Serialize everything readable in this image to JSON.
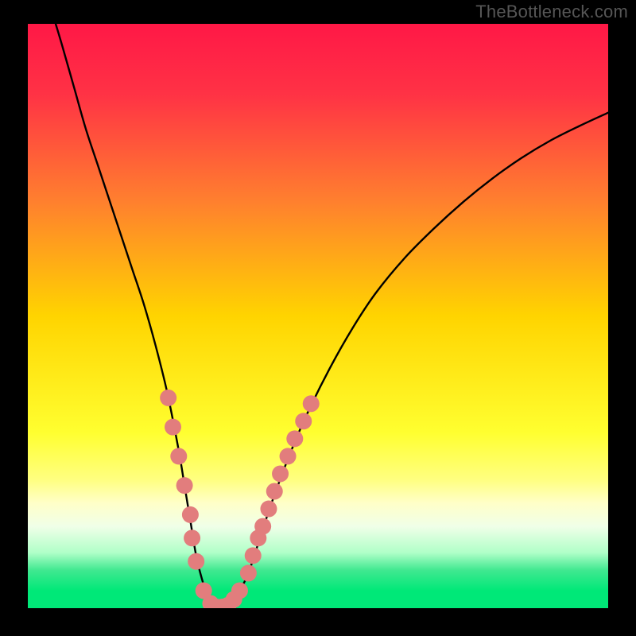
{
  "watermark": "TheBottleneck.com",
  "chart_data": {
    "type": "line",
    "title": "",
    "xlabel": "",
    "ylabel": "",
    "xlim": [
      0,
      100
    ],
    "ylim": [
      0,
      100
    ],
    "gradient_stops": [
      {
        "pos": 0.0,
        "color": "#ff1846"
      },
      {
        "pos": 0.12,
        "color": "#ff3245"
      },
      {
        "pos": 0.3,
        "color": "#ff7e2f"
      },
      {
        "pos": 0.5,
        "color": "#ffd400"
      },
      {
        "pos": 0.7,
        "color": "#ffff30"
      },
      {
        "pos": 0.78,
        "color": "#ffff80"
      },
      {
        "pos": 0.82,
        "color": "#ffffc8"
      },
      {
        "pos": 0.86,
        "color": "#f0ffe8"
      },
      {
        "pos": 0.905,
        "color": "#b0ffc8"
      },
      {
        "pos": 0.935,
        "color": "#40e890"
      },
      {
        "pos": 0.97,
        "color": "#00e878"
      },
      {
        "pos": 1.0,
        "color": "#00e878"
      }
    ],
    "series": [
      {
        "name": "curve",
        "x": [
          4.8,
          6,
          8,
          10,
          12,
          14,
          16,
          18,
          20,
          22,
          24,
          26,
          27,
          28,
          29,
          30,
          31,
          32,
          33,
          34,
          35,
          36,
          38,
          40,
          42,
          45,
          48,
          52,
          56,
          60,
          65,
          70,
          75,
          80,
          85,
          90,
          95,
          100
        ],
        "y": [
          100,
          96,
          89,
          82,
          76,
          70,
          64,
          58,
          52,
          45,
          37,
          27,
          21,
          15,
          9,
          5,
          2,
          0.4,
          0,
          0,
          0.4,
          2,
          6,
          12,
          18,
          26,
          33,
          41,
          48,
          54,
          60,
          65,
          69.5,
          73.5,
          77,
          80,
          82.5,
          84.8
        ]
      }
    ],
    "dots": {
      "color": "#e27d7d",
      "points": [
        {
          "x": 24.2,
          "y": 36
        },
        {
          "x": 25.0,
          "y": 31
        },
        {
          "x": 26.0,
          "y": 26
        },
        {
          "x": 27.0,
          "y": 21
        },
        {
          "x": 28.0,
          "y": 16
        },
        {
          "x": 28.3,
          "y": 12
        },
        {
          "x": 29.0,
          "y": 8
        },
        {
          "x": 30.3,
          "y": 3
        },
        {
          "x": 31.5,
          "y": 0.8
        },
        {
          "x": 32.5,
          "y": 0.2
        },
        {
          "x": 33.5,
          "y": 0.2
        },
        {
          "x": 34.5,
          "y": 0.5
        },
        {
          "x": 35.5,
          "y": 1.5
        },
        {
          "x": 36.5,
          "y": 3
        },
        {
          "x": 38.0,
          "y": 6
        },
        {
          "x": 38.8,
          "y": 9
        },
        {
          "x": 39.7,
          "y": 12
        },
        {
          "x": 40.5,
          "y": 14
        },
        {
          "x": 41.5,
          "y": 17
        },
        {
          "x": 42.5,
          "y": 20
        },
        {
          "x": 43.5,
          "y": 23
        },
        {
          "x": 44.8,
          "y": 26
        },
        {
          "x": 46.0,
          "y": 29
        },
        {
          "x": 47.5,
          "y": 32
        },
        {
          "x": 48.8,
          "y": 35
        }
      ]
    }
  }
}
